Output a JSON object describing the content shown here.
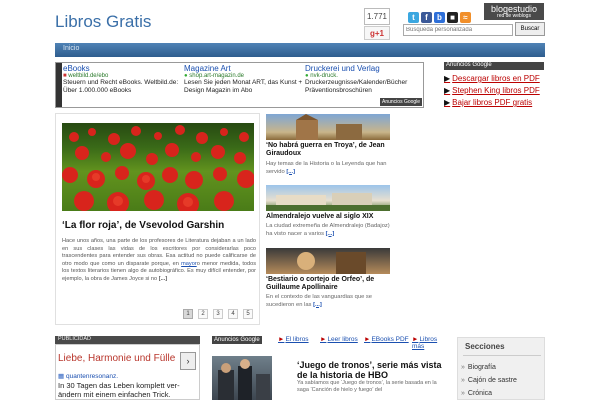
{
  "header": {
    "site_title": "Libros Gratis",
    "share_count": "1.771",
    "gplus_label": "g+1",
    "brand": "blogestudio",
    "brand_sub": "red de weblogs",
    "search_placeholder": "Búsqueda personalizada",
    "search_google": "Google",
    "search_button": "Buscar"
  },
  "nav": {
    "home": "Inicio"
  },
  "ad_strip": {
    "items": [
      {
        "title": "eBooks",
        "url": "weltbild.de/ebo",
        "desc": "Steuern und Recht eBooks. Weltbild.de: Über 1.000.000 eBooks"
      },
      {
        "title": "Magazine Art",
        "url": "shop.art-magazin.de",
        "desc": "Lesen Sie jeden Monat ART, das Kunst + Design Magazin im Abo"
      },
      {
        "title": "Druckerei und Verlag",
        "url": "nvk-druck.",
        "desc": "Druckerzeugnisse/Kalender/Bücher Präventionsbroschüren"
      }
    ],
    "badge": "Anuncios Google"
  },
  "right_ads": {
    "header": "Anuncios Google",
    "links": [
      "Descargar libros en PDF",
      "Stephen King libros PDF",
      "Bajar libros PDF gratis"
    ]
  },
  "feature": {
    "title": "‘La flor roja’, de Vsevolod Garshin",
    "text": "Hace unos años, una parte de los profesores de Literatura dejaban a un lado en sus clases las vidas de los escritores por considerarlas poco trascendentes para entender sus obras. Esa actitud no puede calificarse de otro modo que como un disparate porque, en",
    "link": "mayor",
    "text2": "o menor medida, todos los textos literarios tienen algo de autobiográfico. Es muy difícil entender, por ejemplo, la obra de James Joyce si no",
    "more": "[...]",
    "pages": [
      "1",
      "2",
      "3",
      "4",
      "5"
    ]
  },
  "stories": [
    {
      "title": "‘No habrá guerra en Troya’, de Jean Giraudoux",
      "text": "Hay temas de la Historia o la Leyenda que han servido",
      "more": "[...]"
    },
    {
      "title": "Almendralejo vuelve al siglo XIX",
      "text": "La ciudad extremeña de Almendralejo (Badajoz) ha visto nacer a varios",
      "more": "[...]"
    },
    {
      "title": "‘Bestiario o cortejo de Orfeo’, de Guillaume Apollinaire",
      "text": "En el contexto de las vanguardias que se sucedieron en las",
      "more": "[...]"
    }
  ],
  "publicidad": {
    "header": "PUBLICIDAD",
    "title": "Liebe, Harmonie und Fülle",
    "url": "quantenresonanz.",
    "text": "In 30 Tagen das Leben komplett ver- ändern mit einem einfachen Trick.",
    "next": "›"
  },
  "bottom_ads": {
    "badge": "Anuncios Google",
    "links": [
      "El libros",
      "Leer libros",
      "EBooks PDF",
      "Libros más"
    ]
  },
  "bottom_story": {
    "title": "‘Juego de tronos’, serie más vista de la historia de HBO",
    "text": "Ya sabíamos que ‘Juego de tronos’, la serie basada en la saga ‘Canción de hielo y fuego’ del"
  },
  "sections": {
    "title": "Secciones",
    "items": [
      "Biografía",
      "Cajón de sastre",
      "Crónica"
    ]
  },
  "colors": {
    "accent": "#3a6fa8",
    "nav": "#2e5d8e",
    "ad_link": "#b00000"
  }
}
